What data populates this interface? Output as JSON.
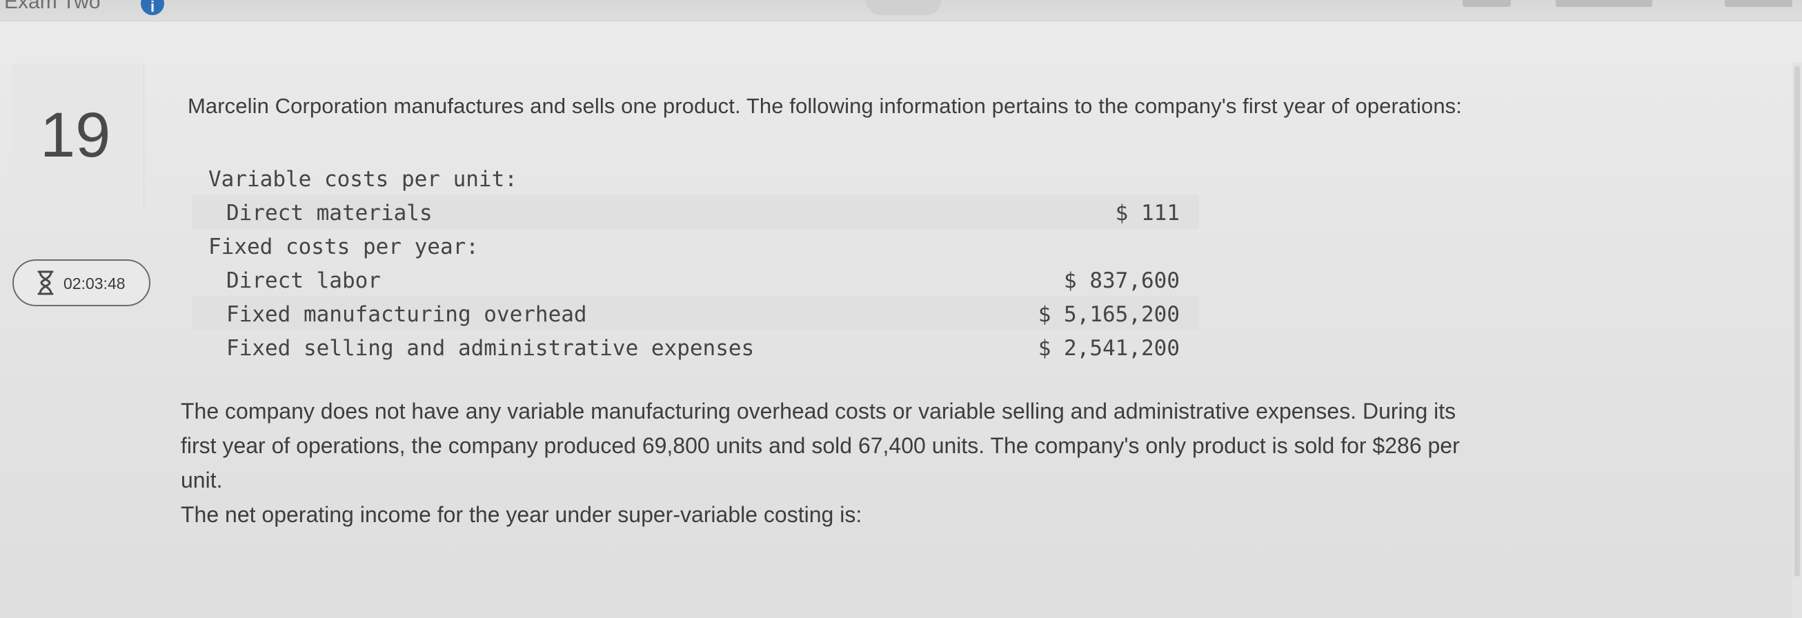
{
  "header": {
    "exam_title": "Exam Two",
    "info_icon": "info-icon"
  },
  "question": {
    "number": "19",
    "timer": "02:03:48",
    "timer_icon": "hourglass-icon",
    "intro": "Marcelin Corporation manufactures and sells one product. The following information pertains to the company's first year of operations:",
    "table": [
      {
        "label": "Variable costs per unit:",
        "value": "",
        "heading": true
      },
      {
        "label": "Direct materials",
        "value": "$ 111",
        "heading": false
      },
      {
        "label": "Fixed costs per year:",
        "value": "",
        "heading": true
      },
      {
        "label": "Direct labor",
        "value": "$ 837,600",
        "heading": false
      },
      {
        "label": "Fixed manufacturing overhead",
        "value": "$ 5,165,200",
        "heading": false
      },
      {
        "label": "Fixed selling and administrative expenses",
        "value": "$ 2,541,200",
        "heading": false
      }
    ],
    "paragraph_lines": [
      "The company does not have any variable manufacturing overhead costs or variable selling and administrative expenses. During its",
      "first year of operations, the company produced 69,800 units and sold 67,400 units. The company's only product is sold for $286 per",
      "unit."
    ],
    "prompt": "The net operating income for the year under super-variable costing is:"
  }
}
